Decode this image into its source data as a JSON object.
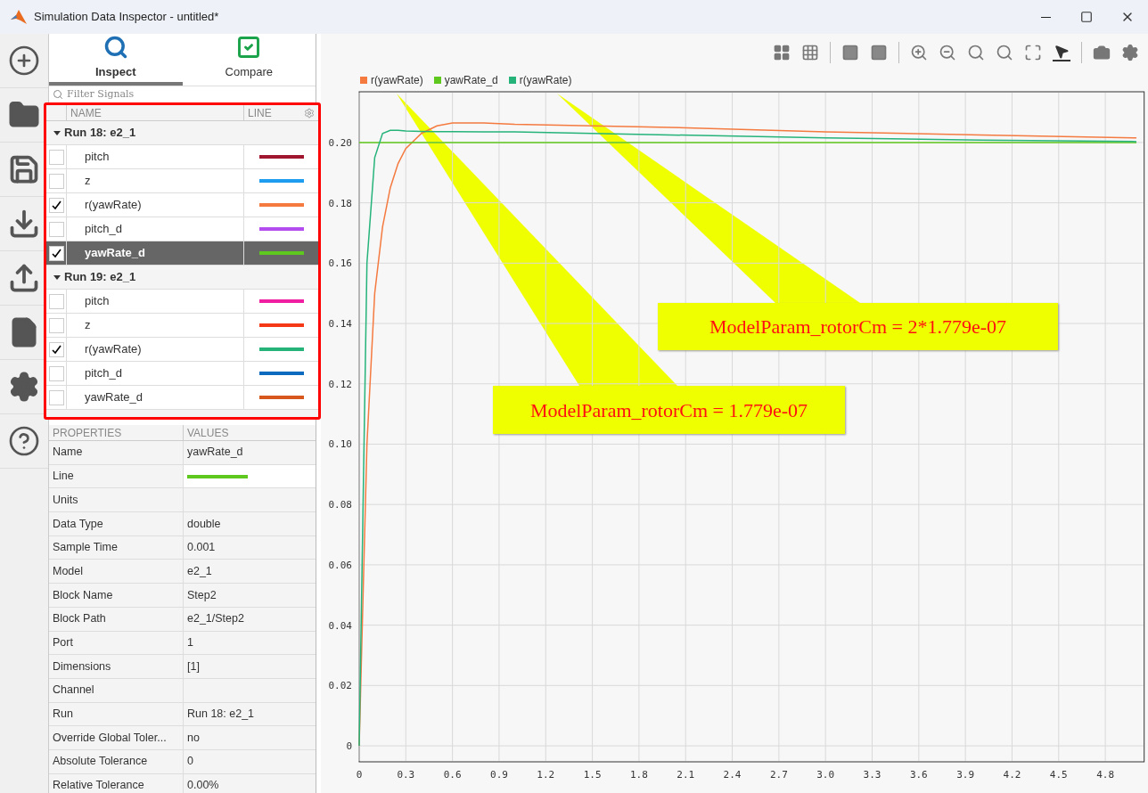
{
  "window": {
    "title": "Simulation Data Inspector - untitled*"
  },
  "tabs": [
    {
      "label": "Inspect",
      "selected": true
    },
    {
      "label": "Compare",
      "selected": false
    }
  ],
  "filter": {
    "placeholder": "Filter Signals"
  },
  "signal_table": {
    "columns": [
      "NAME",
      "LINE"
    ],
    "runs": [
      {
        "label": "Run 18: e2_1",
        "expanded": true,
        "signals": [
          {
            "name": "pitch",
            "checked": false,
            "selected": false,
            "color": "#a0162e"
          },
          {
            "name": "z",
            "checked": false,
            "selected": false,
            "color": "#1e9cf0"
          },
          {
            "name": "r(yawRate)",
            "checked": true,
            "selected": false,
            "color": "#f47a40"
          },
          {
            "name": "pitch_d",
            "checked": false,
            "selected": false,
            "color": "#b44df0"
          },
          {
            "name": "yawRate_d",
            "checked": true,
            "selected": true,
            "color": "#5fc81e"
          }
        ]
      },
      {
        "label": "Run 19: e2_1",
        "expanded": true,
        "signals": [
          {
            "name": "pitch",
            "checked": false,
            "selected": false,
            "color": "#f01ea0"
          },
          {
            "name": "z",
            "checked": false,
            "selected": false,
            "color": "#f53816"
          },
          {
            "name": "r(yawRate)",
            "checked": true,
            "selected": false,
            "color": "#25b37a"
          },
          {
            "name": "pitch_d",
            "checked": false,
            "selected": false,
            "color": "#0d6bbf"
          },
          {
            "name": "yawRate_d",
            "checked": false,
            "selected": false,
            "color": "#d8571c"
          }
        ]
      }
    ]
  },
  "properties": {
    "columns": [
      "PROPERTIES",
      "VALUES"
    ],
    "rows": [
      {
        "kind": "text",
        "name": "Name",
        "value": "yawRate_d"
      },
      {
        "kind": "line",
        "name": "Line",
        "color": "#5fc81e"
      },
      {
        "kind": "text",
        "name": "Units"
      },
      {
        "kind": "text",
        "name": "Data Type",
        "value": "double"
      },
      {
        "kind": "text",
        "name": "Sample Time",
        "value": "0.001"
      },
      {
        "kind": "text",
        "name": "Model",
        "value": "e2_1"
      },
      {
        "kind": "text",
        "name": "Block Name",
        "value": "Step2"
      },
      {
        "kind": "text",
        "name": "Block Path",
        "value": "e2_1/Step2"
      },
      {
        "kind": "text",
        "name": "Port",
        "value": "1"
      },
      {
        "kind": "text",
        "name": "Dimensions",
        "value": "[1]"
      },
      {
        "kind": "text",
        "name": "Channel"
      },
      {
        "kind": "text",
        "name": "Run",
        "value": "Run 18: e2_1"
      },
      {
        "kind": "text",
        "name": "Override Global Toler...",
        "value": "no"
      },
      {
        "kind": "text",
        "name": "Absolute Tolerance",
        "value": "0"
      },
      {
        "kind": "text",
        "name": "Relative Tolerance",
        "value": "0.00%"
      }
    ]
  },
  "plot": {
    "chart_data": {
      "type": "line",
      "x": [
        0,
        0.05,
        0.1,
        0.15,
        0.2,
        0.25,
        0.3,
        0.4,
        0.5,
        0.6,
        0.8,
        1,
        1.5,
        2,
        3,
        4,
        5
      ],
      "series": [
        {
          "name": "r(yawRate)",
          "color": "#f47a40",
          "values": [
            0,
            0.1,
            0.15,
            0.172,
            0.185,
            0.193,
            0.198,
            0.203,
            0.2055,
            0.2065,
            0.2065,
            0.206,
            0.2055,
            0.205,
            0.2035,
            0.2025,
            0.2015
          ]
        },
        {
          "name": "yawRate_d",
          "color": "#5fc81e",
          "values": [
            0.2,
            0.2,
            0.2,
            0.2,
            0.2,
            0.2,
            0.2,
            0.2,
            0.2,
            0.2,
            0.2,
            0.2,
            0.2,
            0.2,
            0.2,
            0.2,
            0.2
          ]
        },
        {
          "name": "r(yawRate)",
          "color": "#25b37a",
          "values": [
            0,
            0.16,
            0.195,
            0.203,
            0.204,
            0.204,
            0.2038,
            0.2037,
            0.2036,
            0.2036,
            0.2035,
            0.2035,
            0.203,
            0.2025,
            0.2015,
            0.2008,
            0.2003
          ]
        }
      ],
      "xlim": [
        0,
        5.05
      ],
      "ylim": [
        -0.0053,
        0.2168
      ],
      "xticks": [
        0,
        0.3,
        0.6,
        0.9,
        1.2,
        1.5,
        1.8,
        2.1,
        2.4,
        2.7,
        {
          "value": 3,
          "label": "3.0"
        },
        3.3,
        3.6,
        3.9,
        4.2,
        4.5,
        4.8
      ],
      "yticks": [
        0,
        0.02,
        0.04,
        0.06,
        0.08,
        {
          "value": 0.1,
          "label": "0.10"
        },
        0.12,
        0.14,
        0.16,
        0.18,
        {
          "value": 0.2,
          "label": "0.20"
        }
      ],
      "grid": true,
      "legend": true,
      "annotations": [
        {
          "text": "ModelParam_rotorCm = 2*1.779e-07"
        },
        {
          "text": "ModelParam_rotorCm = 1.779e-07"
        }
      ]
    }
  }
}
